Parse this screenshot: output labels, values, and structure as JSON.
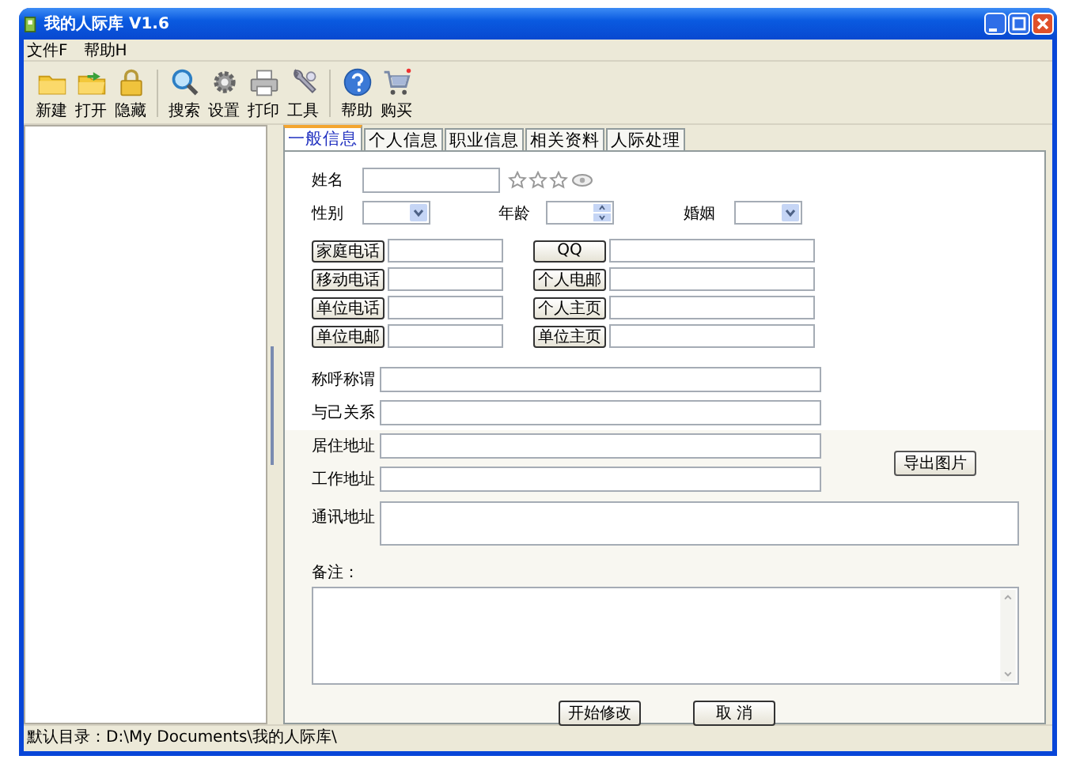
{
  "window": {
    "title": "我的人际库 V1.6"
  },
  "menu": [
    "文件F",
    "帮助H"
  ],
  "toolbar": [
    [
      {
        "label": "新建",
        "kind": "new"
      },
      {
        "label": "打开",
        "kind": "open"
      },
      {
        "label": "隐藏",
        "kind": "lock"
      }
    ],
    [
      {
        "label": "搜索",
        "kind": "search"
      },
      {
        "label": "设置",
        "kind": "settings"
      },
      {
        "label": "打印",
        "kind": "print"
      },
      {
        "label": "工具",
        "kind": "tools"
      }
    ],
    [
      {
        "label": "帮助",
        "kind": "help"
      },
      {
        "label": "购买",
        "kind": "cart"
      }
    ]
  ],
  "tabs": [
    {
      "label": "一般信息",
      "selected": true
    },
    {
      "label": "个人信息",
      "selected": false
    },
    {
      "label": "职业信息",
      "selected": false
    },
    {
      "label": "相关资料",
      "selected": false
    },
    {
      "label": "人际处理",
      "selected": false
    }
  ],
  "form": {
    "name_label": "姓名",
    "stars": 0,
    "gender_label": "性别",
    "age_label": "年龄",
    "marriage_label": "婚姻",
    "contact_rows": [
      {
        "left": "家庭电话",
        "right": "QQ"
      },
      {
        "left": "移动电话",
        "right": "个人电邮"
      },
      {
        "left": "单位电话",
        "right": "个人主页"
      },
      {
        "left": "单位电邮",
        "right": "单位主页"
      }
    ],
    "text_fields": [
      "称呼称谓",
      "与己关系",
      "居住地址",
      "工作地址"
    ],
    "export_button": "导出图片",
    "address_label": "通讯地址",
    "notes_label": "备注：",
    "buttons": [
      "开始修改",
      "取 消"
    ]
  },
  "status_bar": "默认目录：D:\\My Documents\\我的人际库\\"
}
